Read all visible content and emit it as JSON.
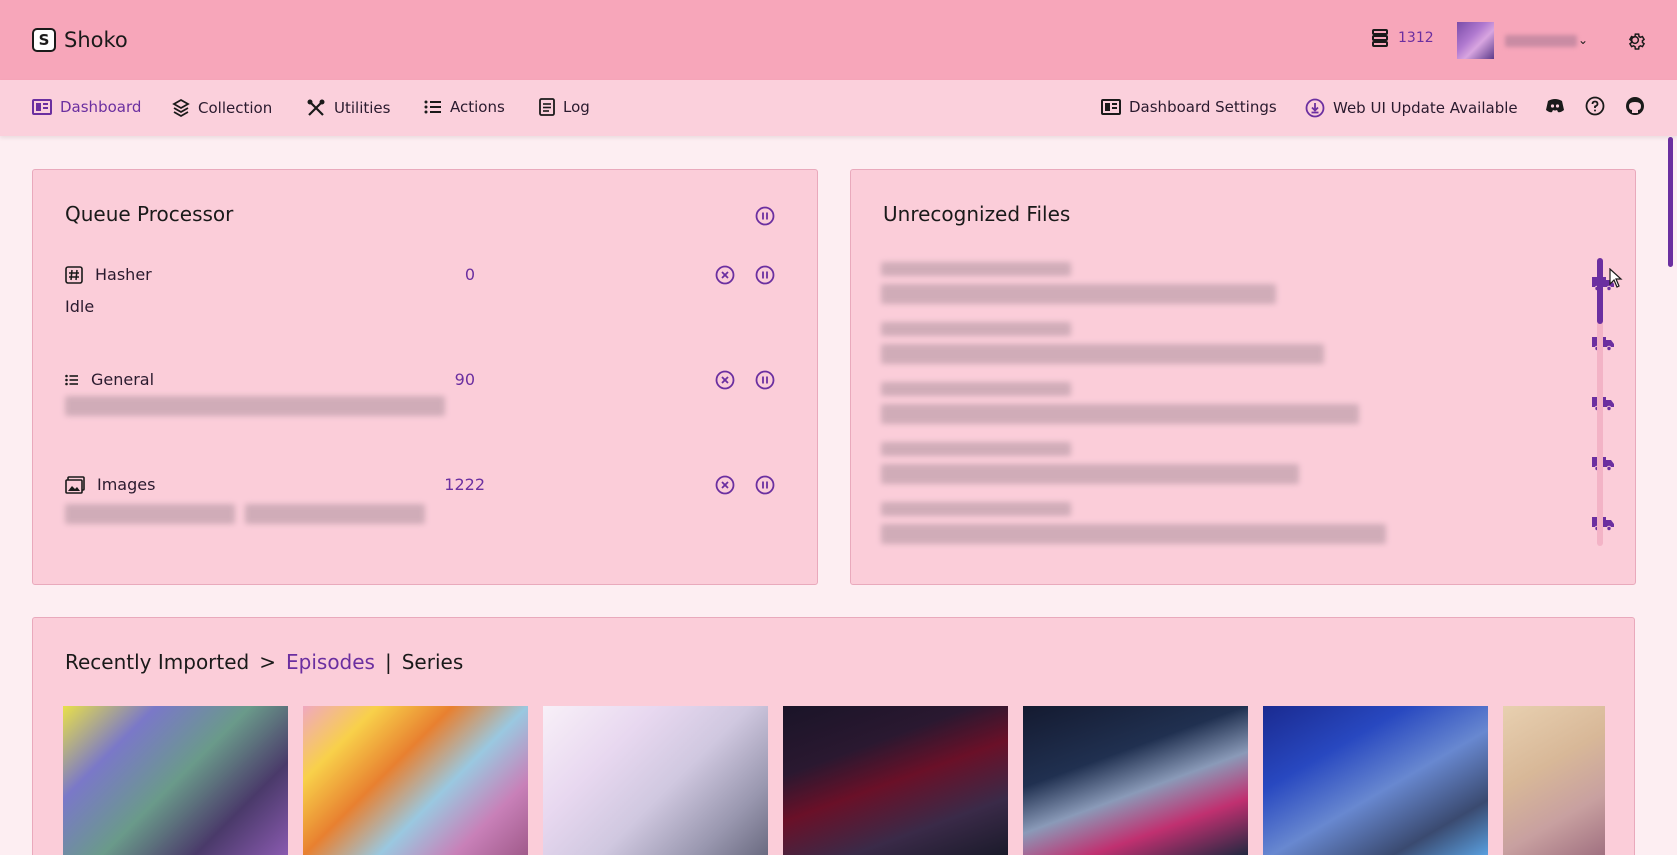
{
  "header": {
    "app_name": "Shoko",
    "logo_letter": "S",
    "queue_count": "1312",
    "accent_color": "#6b2fa0"
  },
  "nav": {
    "left": [
      {
        "label": "Dashboard",
        "icon": "dashboard-icon",
        "active": true
      },
      {
        "label": "Collection",
        "icon": "layers-icon"
      },
      {
        "label": "Utilities",
        "icon": "tools-icon"
      },
      {
        "label": "Actions",
        "icon": "list-icon"
      },
      {
        "label": "Log",
        "icon": "log-icon"
      }
    ],
    "right": [
      {
        "label": "Dashboard Settings",
        "icon": "dashboard-settings-icon"
      },
      {
        "label": "Web UI Update Available",
        "icon": "download-icon"
      }
    ],
    "icons": [
      "discord-icon",
      "help-icon",
      "github-icon"
    ]
  },
  "queue": {
    "title": "Queue Processor",
    "rows": [
      {
        "name": "Hasher",
        "icon": "hash-icon",
        "count": "0",
        "status": "Idle"
      },
      {
        "name": "General",
        "icon": "list-icon",
        "count": "90",
        "status": ""
      },
      {
        "name": "Images",
        "icon": "images-icon",
        "count": "1222",
        "status": ""
      }
    ]
  },
  "unrecognized": {
    "title": "Unrecognized Files",
    "item_count": 5
  },
  "recent": {
    "title": "Recently Imported",
    "separator": ">",
    "tab_episodes": "Episodes",
    "divider": "|",
    "tab_series": "Series"
  }
}
